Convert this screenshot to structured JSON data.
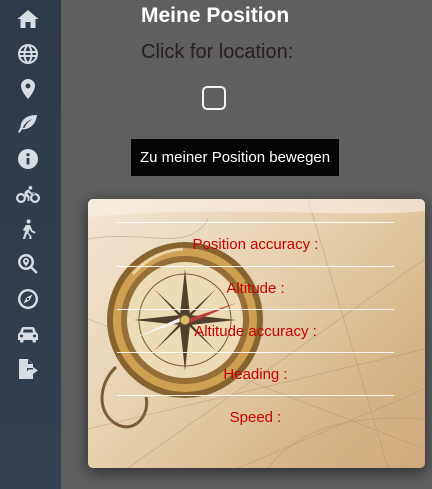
{
  "sidebar": {
    "items": [
      {
        "name": "sidebar-item-home",
        "icon": "home-icon"
      },
      {
        "name": "sidebar-item-globe",
        "icon": "globe-icon"
      },
      {
        "name": "sidebar-item-location",
        "icon": "map-marker-icon"
      },
      {
        "name": "sidebar-item-nature",
        "icon": "leaf-icon"
      },
      {
        "name": "sidebar-item-info",
        "icon": "info-icon"
      },
      {
        "name": "sidebar-item-cycling",
        "icon": "bicycle-icon"
      },
      {
        "name": "sidebar-item-hiking",
        "icon": "hiking-icon"
      },
      {
        "name": "sidebar-item-search",
        "icon": "search-location-icon"
      },
      {
        "name": "sidebar-item-compass",
        "icon": "compass-icon"
      },
      {
        "name": "sidebar-item-car",
        "icon": "car-icon"
      },
      {
        "name": "sidebar-item-export",
        "icon": "file-export-icon"
      }
    ]
  },
  "main": {
    "title": "Meine Position",
    "subtitle": "Click for location:",
    "button_label": "Zu meiner Position bewegen"
  },
  "info": {
    "rows": [
      {
        "label": "Position accuracy :"
      },
      {
        "label": "Altitude :"
      },
      {
        "label": "Altitude accuracy :"
      },
      {
        "label": "Heading :"
      },
      {
        "label": "Speed :"
      }
    ]
  },
  "colors": {
    "sidebar": "#313c4a",
    "background": "#5f5f5f",
    "label": "#c80000",
    "button": "#050505"
  }
}
